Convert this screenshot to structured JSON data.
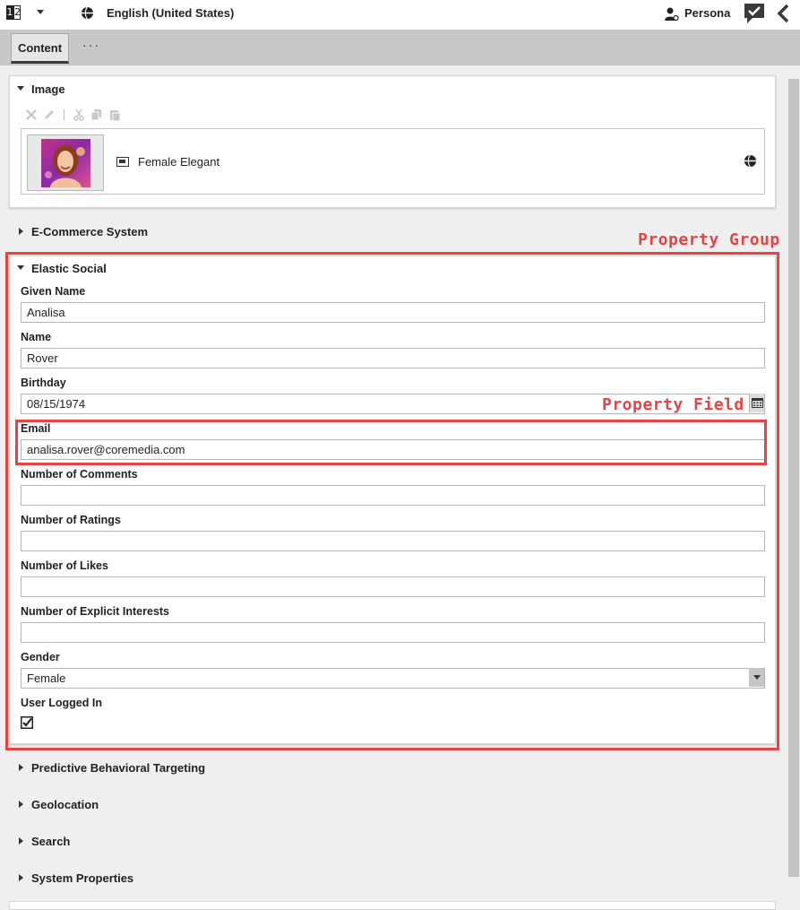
{
  "topbar": {
    "split_left": "1",
    "split_right": "2",
    "language": "English (United States)",
    "persona_label": "Persona"
  },
  "tabs": {
    "content_label": "Content",
    "more_label": "···"
  },
  "image_group": {
    "title": "Image",
    "item_name": "Female Elegant"
  },
  "ecommerce_group": {
    "title": "E-Commerce System"
  },
  "elastic_group": {
    "title": "Elastic Social",
    "fields": {
      "given_name": {
        "label": "Given Name",
        "value": "Analisa"
      },
      "name": {
        "label": "Name",
        "value": "Rover"
      },
      "birthday": {
        "label": "Birthday",
        "value": "08/15/1974"
      },
      "email": {
        "label": "Email",
        "value": "analisa.rover@coremedia.com"
      },
      "comments": {
        "label": "Number of Comments",
        "value": ""
      },
      "ratings": {
        "label": "Number of Ratings",
        "value": ""
      },
      "likes": {
        "label": "Number of Likes",
        "value": ""
      },
      "interests": {
        "label": "Number of Explicit Interests",
        "value": ""
      },
      "gender": {
        "label": "Gender",
        "value": "Female"
      },
      "logged_in": {
        "label": "User Logged In",
        "checked": true
      }
    }
  },
  "collapsed_groups": {
    "predictive": "Predictive Behavioral Targeting",
    "geolocation": "Geolocation",
    "search": "Search",
    "system": "System Properties"
  },
  "annotations": {
    "property_group": "Property Group",
    "property_field": "Property Field",
    "color": "#e84242"
  }
}
